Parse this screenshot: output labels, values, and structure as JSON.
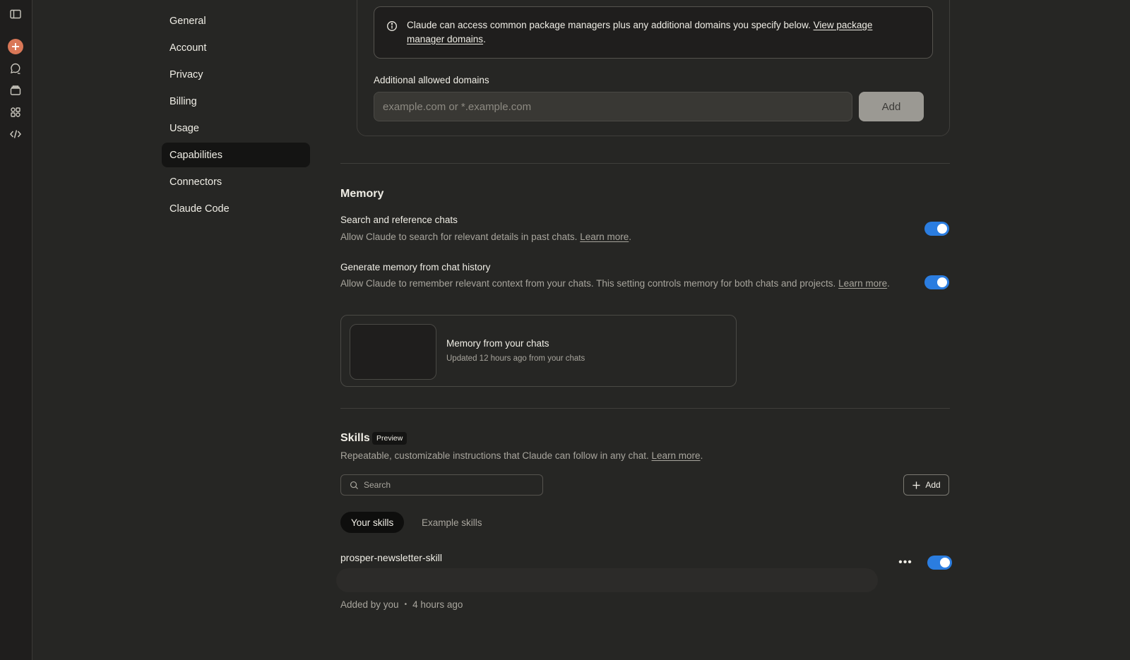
{
  "rail": {
    "icons": [
      "sidebar-toggle-icon",
      "new-chat-icon",
      "chats-icon",
      "projects-icon",
      "artifacts-icon",
      "code-icon"
    ]
  },
  "nav": {
    "items": [
      {
        "label": "General"
      },
      {
        "label": "Account"
      },
      {
        "label": "Privacy"
      },
      {
        "label": "Billing"
      },
      {
        "label": "Usage"
      },
      {
        "label": "Capabilities",
        "active": true
      },
      {
        "label": "Connectors"
      },
      {
        "label": "Claude Code"
      }
    ]
  },
  "network": {
    "info_text": "Claude can access common package managers plus any additional domains you specify below.",
    "info_link": "View package manager domains",
    "info_end": ".",
    "allowed_label": "Additional allowed domains",
    "domain_placeholder": "example.com or *.example.com",
    "add_label": "Add"
  },
  "memory": {
    "title": "Memory",
    "search_chats": {
      "title": "Search and reference chats",
      "desc": "Allow Claude to search for relevant details in past chats.",
      "link": "Learn more",
      "end": ".",
      "enabled": true
    },
    "generate": {
      "title": "Generate memory from chat history",
      "desc": "Allow Claude to remember relevant context from your chats. This setting controls memory for both chats and projects.",
      "link": "Learn more",
      "end": ".",
      "enabled": true
    },
    "card": {
      "title": "Memory from your chats",
      "subtitle": "Updated 12 hours ago from your chats"
    }
  },
  "skills": {
    "title": "Skills",
    "badge": "Preview",
    "desc": "Repeatable, customizable instructions that Claude can follow in any chat.",
    "link": "Learn more",
    "end": ".",
    "search_placeholder": "Search",
    "add_label": "Add",
    "tabs": [
      {
        "label": "Your skills",
        "active": true
      },
      {
        "label": "Example skills",
        "active": false
      }
    ],
    "items": [
      {
        "name": "prosper-newsletter-skill",
        "added_by": "Added by you",
        "time": "4 hours ago",
        "enabled": true
      }
    ]
  },
  "colors": {
    "background": "#262624",
    "accent": "#d97757",
    "toggle_on": "#2b7de0"
  }
}
